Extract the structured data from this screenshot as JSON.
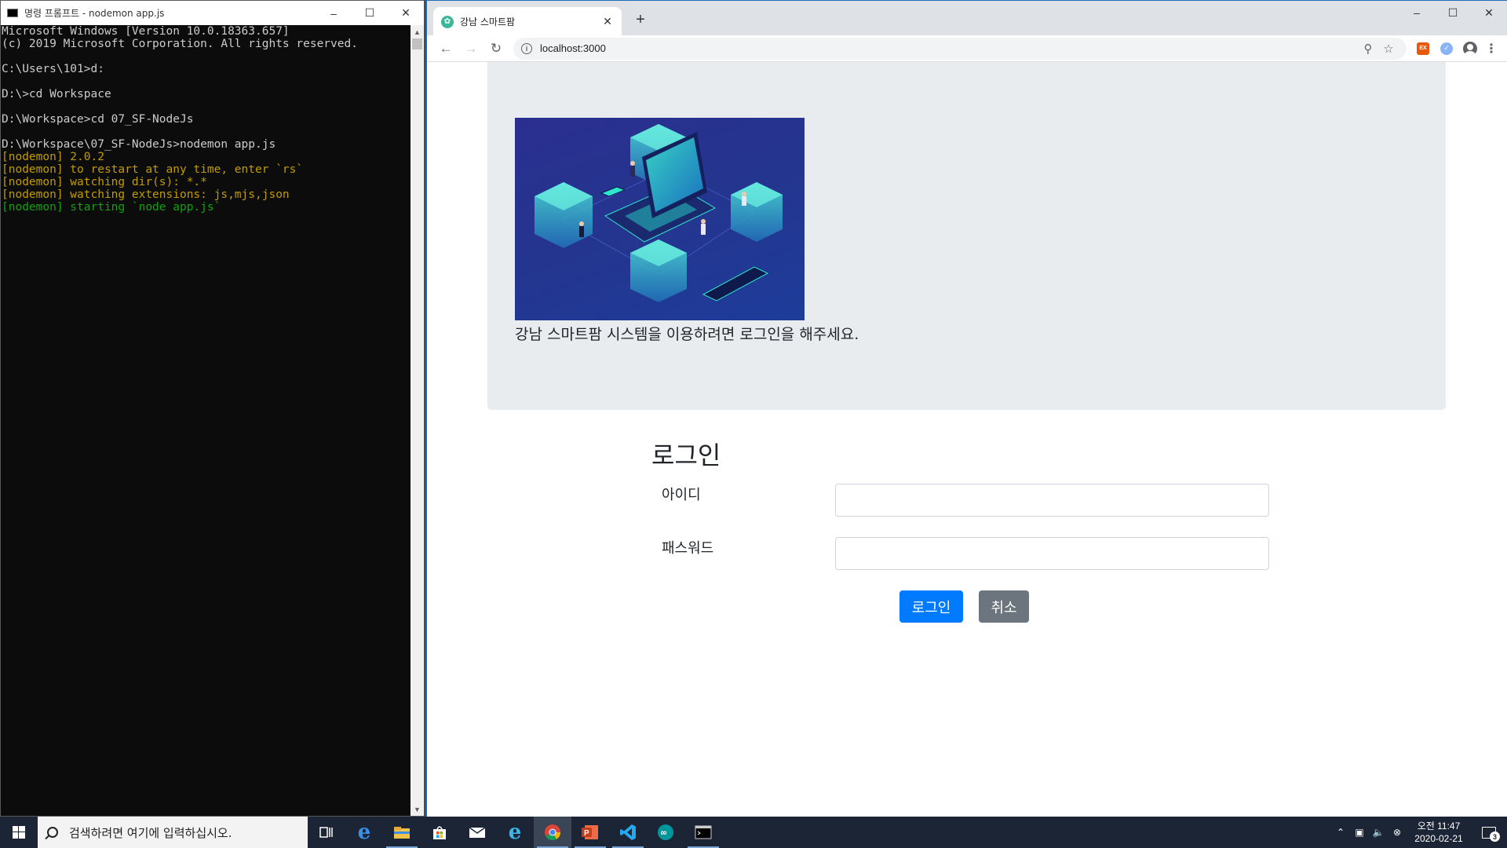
{
  "cmd": {
    "title": "명령 프롬프트 - nodemon  app.js",
    "lines": [
      {
        "text": "Microsoft Windows [Version 10.0.18363.657]",
        "color": "#cccccc"
      },
      {
        "text": "(c) 2019 Microsoft Corporation. All rights reserved.",
        "color": "#cccccc"
      },
      {
        "text": "",
        "color": "#cccccc"
      },
      {
        "text": "C:\\Users\\101>d:",
        "color": "#cccccc"
      },
      {
        "text": "",
        "color": "#cccccc"
      },
      {
        "text": "D:\\>cd Workspace",
        "color": "#cccccc"
      },
      {
        "text": "",
        "color": "#cccccc"
      },
      {
        "text": "D:\\Workspace>cd 07_SF-NodeJs",
        "color": "#cccccc"
      },
      {
        "text": "",
        "color": "#cccccc"
      },
      {
        "text": "D:\\Workspace\\07_SF-NodeJs>nodemon app.js",
        "color": "#cccccc"
      },
      {
        "text": "[nodemon] 2.0.2",
        "color": "#c19c00"
      },
      {
        "text": "[nodemon] to restart at any time, enter `rs`",
        "color": "#c19c00"
      },
      {
        "text": "[nodemon] watching dir(s): *.*",
        "color": "#c19c00"
      },
      {
        "text": "[nodemon] watching extensions: js,mjs,json",
        "color": "#c19c00"
      },
      {
        "text": "[nodemon] starting `node app.js`",
        "color": "#13a10e"
      }
    ]
  },
  "browser": {
    "tab_title": "강남 스마트팜",
    "url": "localhost:3000",
    "new_tab": "+",
    "ext_red_label": "EX"
  },
  "page": {
    "lead": "강남 스마트팜 시스템을 이용하려면 로그인을 해주세요.",
    "login_title": "로그인",
    "id_label": "아이디",
    "id_value": "",
    "password_label": "패스워드",
    "password_value": "",
    "login_button": "로그인",
    "cancel_button": "취소"
  },
  "taskbar": {
    "search_placeholder": "검색하려면 여기에 입력하십시오.",
    "time": "오전 11:47",
    "date": "2020-02-21",
    "notification_count": "3"
  }
}
